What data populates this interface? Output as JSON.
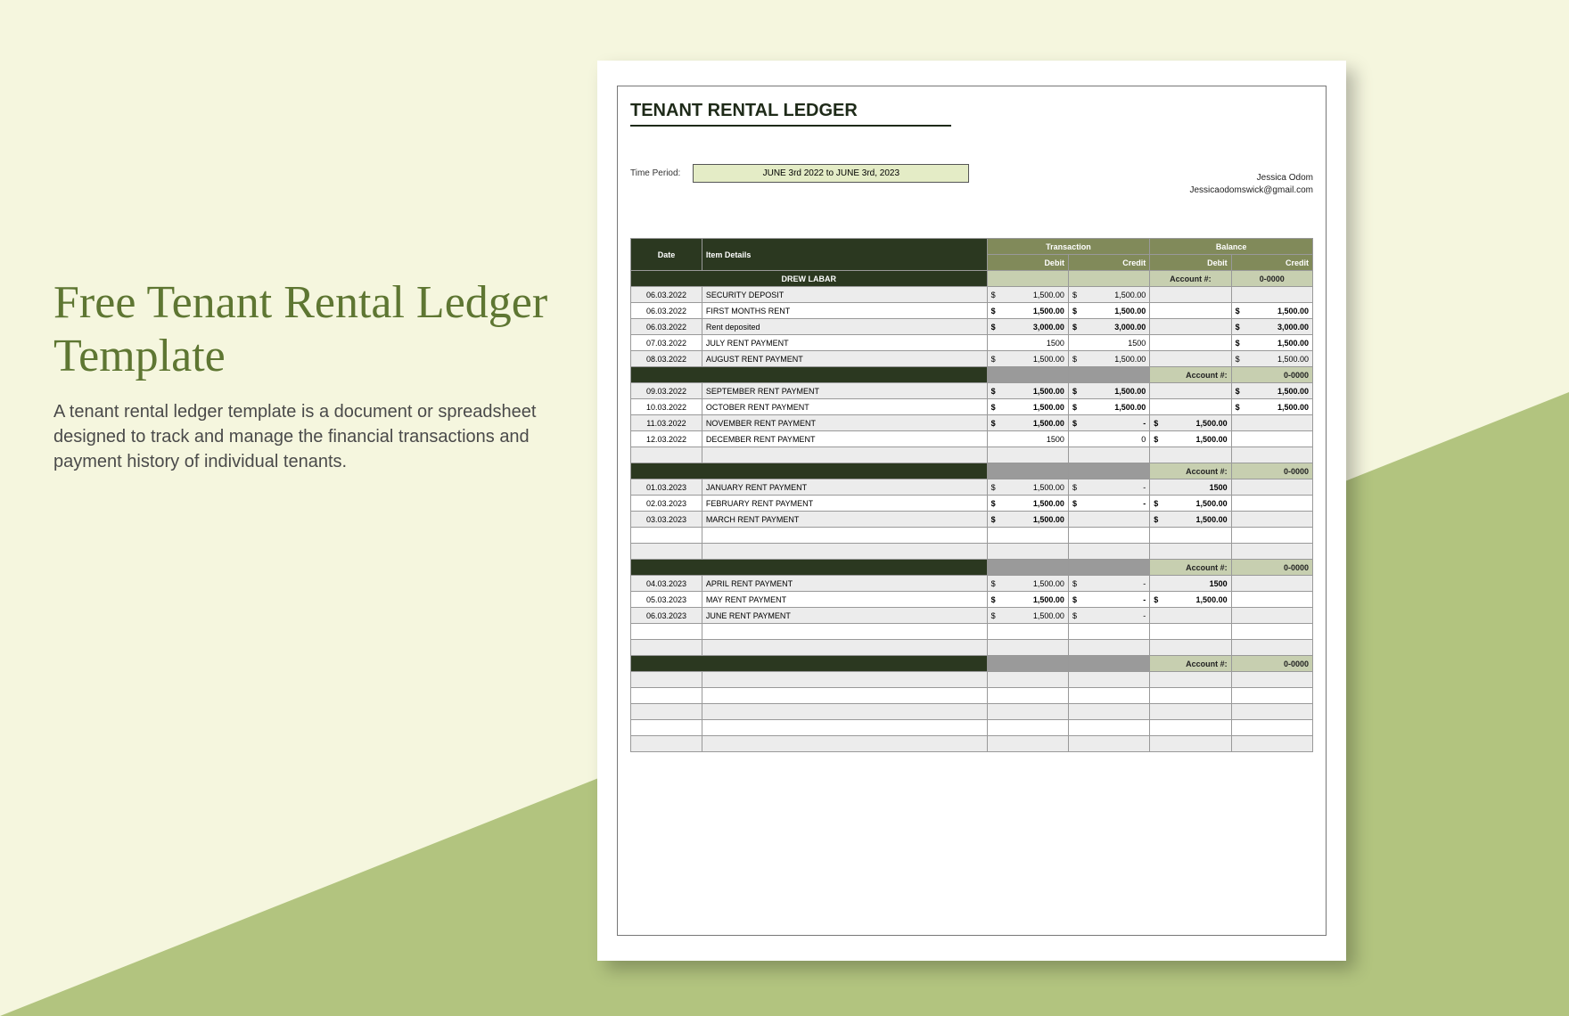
{
  "promo": {
    "headline": "Free Tenant Rental Ledger Template",
    "subtext": "A tenant rental ledger template is a document or spreadsheet designed to track and manage the financial transactions and payment history of individual tenants."
  },
  "doc": {
    "title": "TENANT RENTAL LEDGER",
    "period_label": "Time Period:",
    "period_value": "JUNE 3rd 2022 to JUNE 3rd, 2023",
    "contact_name": "Jessica Odom",
    "contact_email": "Jessicaodomswick@gmail.com",
    "headers": {
      "date": "Date",
      "item": "Item Details",
      "transaction": "Transaction",
      "balance": "Balance",
      "debit": "Debit",
      "credit": "Credit",
      "account": "Account #:",
      "account_val": "0-0000"
    },
    "tenant": "DREW LABAR",
    "sections": [
      {
        "rows": [
          {
            "date": "06.03.2022",
            "item": "SECURITY DEPOSIT",
            "td": "1,500.00",
            "tc": "1,500.00",
            "bd": "",
            "bc": ""
          },
          {
            "date": "06.03.2022",
            "item": "FIRST MONTHS RENT",
            "td": "1,500.00",
            "tc": "1,500.00",
            "bd": "",
            "bc": "1,500.00",
            "bold": true
          },
          {
            "date": "06.03.2022",
            "item": "Rent deposited",
            "td": "3,000.00",
            "tc": "3,000.00",
            "bd": "",
            "bc": "3,000.00",
            "bold": true
          },
          {
            "date": "07.03.2022",
            "item": "JULY RENT PAYMENT",
            "td": "1500",
            "tc": "1500",
            "bd": "",
            "bc": "1,500.00",
            "plain": true,
            "bold": true
          },
          {
            "date": "08.03.2022",
            "item": "AUGUST RENT PAYMENT",
            "td": "1,500.00",
            "tc": "1,500.00",
            "bd": "",
            "bc": "1,500.00"
          }
        ]
      },
      {
        "rows": [
          {
            "date": "09.03.2022",
            "item": "SEPTEMBER RENT PAYMENT",
            "td": "1,500.00",
            "tc": "1,500.00",
            "bd": "",
            "bc": "1,500.00",
            "bold": true
          },
          {
            "date": "10.03.2022",
            "item": "OCTOBER RENT PAYMENT",
            "td": "1,500.00",
            "tc": "1,500.00",
            "bd": "",
            "bc": "1,500.00",
            "bold": true
          },
          {
            "date": "11.03.2022",
            "item": "NOVEMBER RENT PAYMENT",
            "td": "1,500.00",
            "tc": "-",
            "bd": "1,500.00",
            "bc": "",
            "bold": true
          },
          {
            "date": "12.03.2022",
            "item": "DECEMBER RENT PAYMENT",
            "td": "1500",
            "tc": "0",
            "bd": "1,500.00",
            "bc": "",
            "plain": true,
            "bold": true
          },
          {
            "date": "",
            "item": "",
            "td": "",
            "tc": "",
            "bd": "",
            "bc": ""
          }
        ]
      },
      {
        "preval": "1500",
        "rows": [
          {
            "date": "01.03.2023",
            "item": "JANUARY RENT PAYMENT",
            "td": "1,500.00",
            "tc": "-",
            "bd": "",
            "bc": ""
          },
          {
            "date": "02.03.2023",
            "item": "FEBRUARY RENT PAYMENT",
            "td": "1,500.00",
            "tc": "-",
            "bd": "1,500.00",
            "bc": "",
            "bold": true
          },
          {
            "date": "03.03.2023",
            "item": "MARCH RENT PAYMENT",
            "td": "1,500.00",
            "tc": "",
            "bd": "1,500.00",
            "bc": "",
            "bold": true
          },
          {
            "date": "",
            "item": "",
            "td": "",
            "tc": "",
            "bd": "",
            "bc": ""
          },
          {
            "date": "",
            "item": "",
            "td": "",
            "tc": "",
            "bd": "",
            "bc": ""
          }
        ]
      },
      {
        "preval": "1500",
        "rows": [
          {
            "date": "04.03.2023",
            "item": "APRIL RENT PAYMENT",
            "td": "1,500.00",
            "tc": "-",
            "bd": "",
            "bc": ""
          },
          {
            "date": "05.03.2023",
            "item": "MAY RENT PAYMENT",
            "td": "1,500.00",
            "tc": "-",
            "bd": "1,500.00",
            "bc": "",
            "bold": true
          },
          {
            "date": "06.03.2023",
            "item": "JUNE RENT PAYMENT",
            "td": "1,500.00",
            "tc": "-",
            "bd": "",
            "bc": ""
          },
          {
            "date": "",
            "item": "",
            "td": "",
            "tc": "",
            "bd": "",
            "bc": ""
          },
          {
            "date": "",
            "item": "",
            "td": "",
            "tc": "",
            "bd": "",
            "bc": ""
          }
        ]
      },
      {
        "rows": [
          {
            "date": "",
            "item": "",
            "td": "",
            "tc": "",
            "bd": "",
            "bc": ""
          },
          {
            "date": "",
            "item": "",
            "td": "",
            "tc": "",
            "bd": "",
            "bc": ""
          },
          {
            "date": "",
            "item": "",
            "td": "",
            "tc": "",
            "bd": "",
            "bc": ""
          },
          {
            "date": "",
            "item": "",
            "td": "",
            "tc": "",
            "bd": "",
            "bc": ""
          },
          {
            "date": "",
            "item": "",
            "td": "",
            "tc": "",
            "bd": "",
            "bc": ""
          }
        ]
      }
    ]
  }
}
